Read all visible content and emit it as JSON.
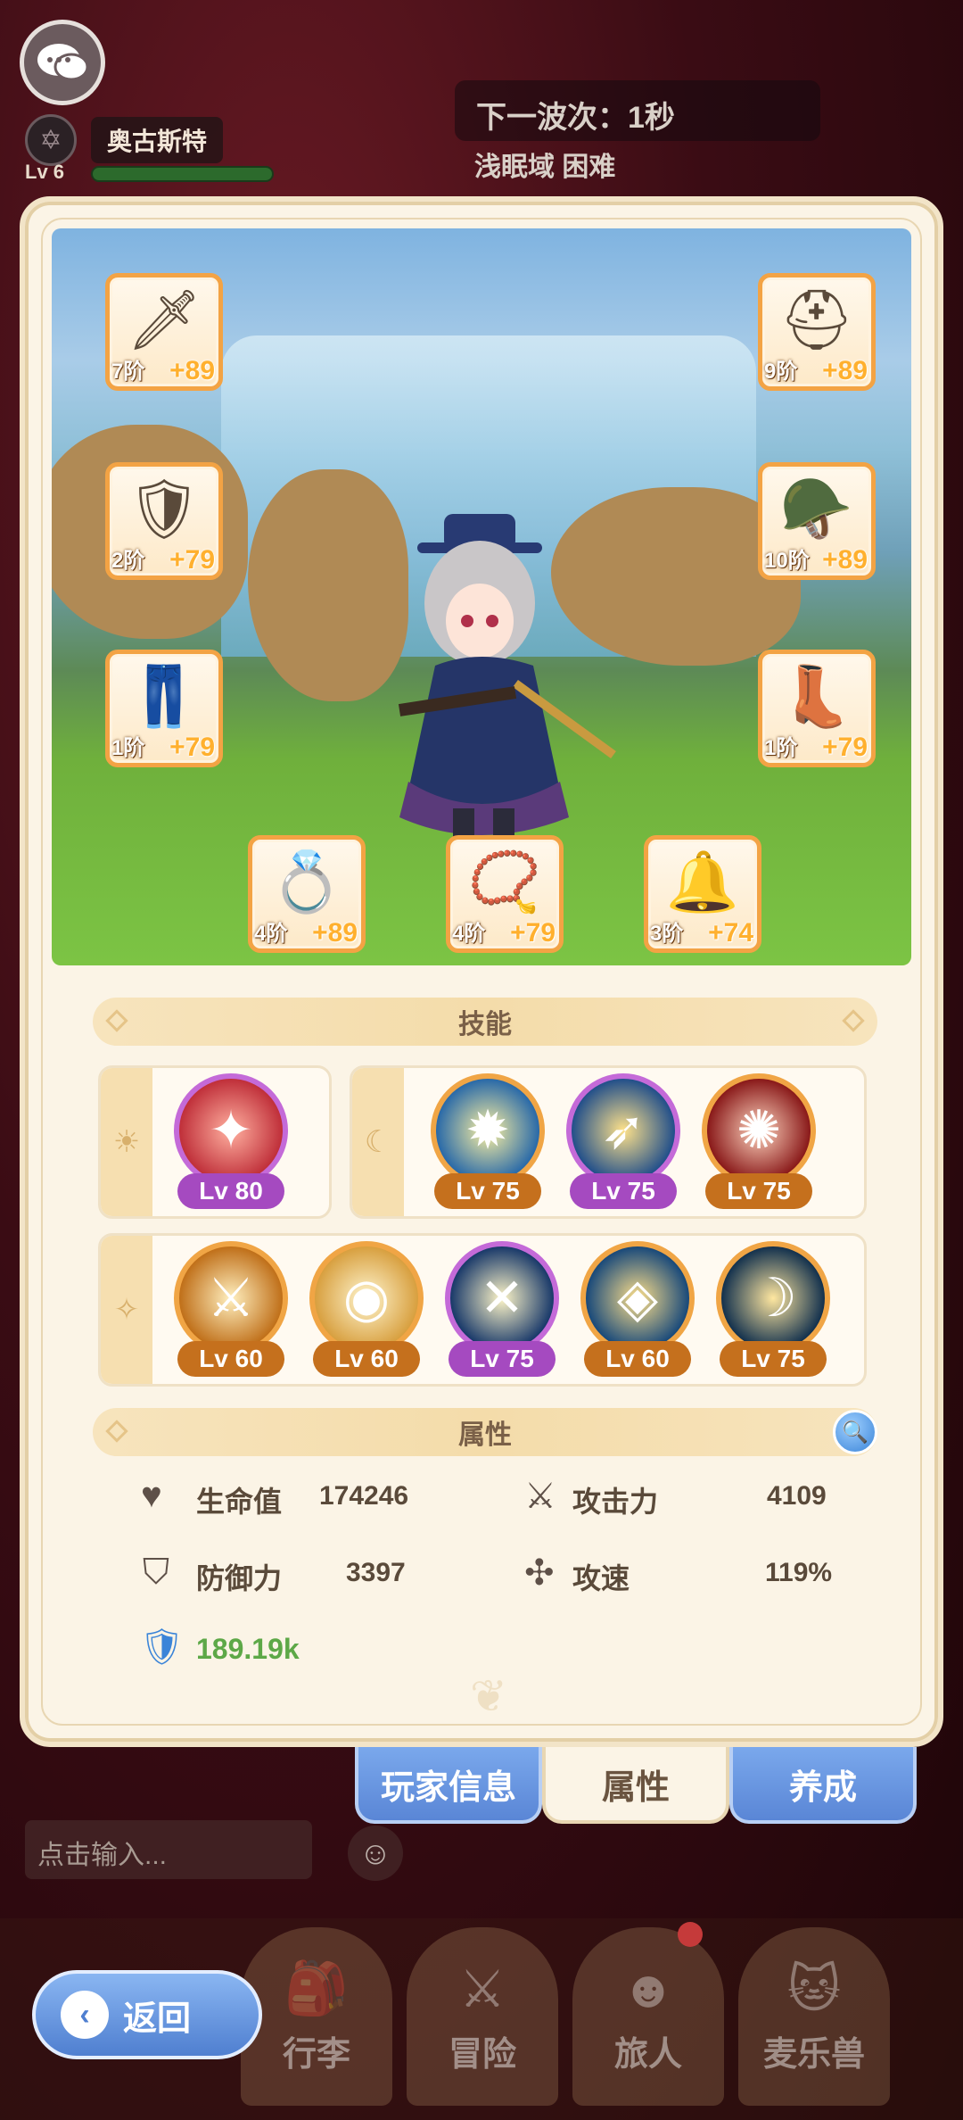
{
  "hud": {
    "player_name": "奥古斯特",
    "player_level": "Lv 6",
    "player_hp_fraction": 0.95,
    "wave_text": "下一波次：1秒",
    "zone_text": "浅眠域 困难"
  },
  "equipment": [
    {
      "slot": "weapon",
      "icon": "sword-icon",
      "tier": "7阶",
      "plus": "+89"
    },
    {
      "slot": "helmet",
      "icon": "helmet-icon",
      "tier": "9阶",
      "plus": "+89"
    },
    {
      "slot": "armor",
      "icon": "armor-icon",
      "tier": "2阶",
      "plus": "+79"
    },
    {
      "slot": "shoulder",
      "icon": "shoulder-icon",
      "tier": "10阶",
      "plus": "+89"
    },
    {
      "slot": "pants",
      "icon": "pants-icon",
      "tier": "1阶",
      "plus": "+79"
    },
    {
      "slot": "boots",
      "icon": "boots-icon",
      "tier": "1阶",
      "plus": "+79"
    },
    {
      "slot": "ring",
      "icon": "ring-icon",
      "tier": "4阶",
      "plus": "+89"
    },
    {
      "slot": "necklace",
      "icon": "necklace-icon",
      "tier": "4阶",
      "plus": "+79"
    },
    {
      "slot": "charm",
      "icon": "charm-icon",
      "tier": "3阶",
      "plus": "+74"
    }
  ],
  "skills_header": "技能",
  "skills": {
    "sun": [
      {
        "icon": "star-burst-icon",
        "level": "Lv 80",
        "rarity": "purple"
      }
    ],
    "moon": [
      {
        "icon": "light-hero-icon",
        "level": "Lv 75",
        "rarity": "orange"
      },
      {
        "icon": "dash-hero-icon",
        "level": "Lv 75",
        "rarity": "purple"
      },
      {
        "icon": "vortex-icon",
        "level": "Lv 75",
        "rarity": "orange"
      }
    ],
    "star": [
      {
        "icon": "slash-icon",
        "level": "Lv 60",
        "rarity": "orange"
      },
      {
        "icon": "eye-sigil-icon",
        "level": "Lv 60",
        "rarity": "orange"
      },
      {
        "icon": "cross-blade-icon",
        "level": "Lv 75",
        "rarity": "purple"
      },
      {
        "icon": "eagle-eye-icon",
        "level": "Lv 60",
        "rarity": "orange"
      },
      {
        "icon": "crescent-icon",
        "level": "Lv 75",
        "rarity": "orange"
      }
    ]
  },
  "attributes_header": "属性",
  "attributes": {
    "hp_label": "生命值",
    "hp_value": "174246",
    "atk_label": "攻击力",
    "atk_value": "4109",
    "def_label": "防御力",
    "def_value": "3397",
    "spd_label": "攻速",
    "spd_value": "119%",
    "power_value": "189.19k"
  },
  "tabs": {
    "player_info": "玩家信息",
    "attributes": "属性",
    "develop": "养成"
  },
  "chat": {
    "placeholder": "点击输入..."
  },
  "nav": {
    "bag": "行李",
    "adventure": "冒险",
    "traveler": "旅人",
    "pet": "麦乐兽",
    "back": "返回"
  },
  "colors": {
    "accent_orange": "#f3a344",
    "accent_purple": "#c46ad8",
    "tab_blue": "#5a86d6",
    "power_green": "#5da847"
  }
}
